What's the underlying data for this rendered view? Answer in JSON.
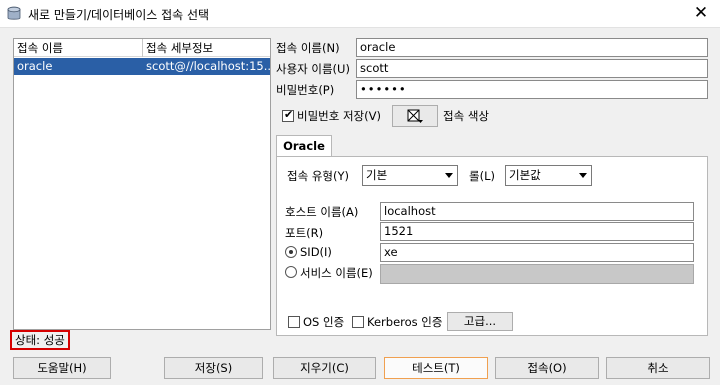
{
  "window": {
    "title": "새로 만들기/데이터베이스 접속 선택",
    "close_symbol": "✕"
  },
  "connection_list": {
    "columns": [
      "접속 이름",
      "접속 세부정보"
    ],
    "rows": [
      {
        "name": "oracle",
        "details": "scott@//localhost:15..."
      }
    ]
  },
  "form": {
    "connection_name": {
      "label": "접속 이름(N)",
      "value": "oracle"
    },
    "username": {
      "label": "사용자 이름(U)",
      "value": "scott"
    },
    "password": {
      "label": "비밀번호(P)",
      "value": "••••••"
    },
    "save_password": {
      "label": "비밀번호 저장(V)",
      "checked": true
    },
    "connection_color": {
      "label": "접속 색상"
    }
  },
  "tab": {
    "label": "Oracle"
  },
  "oracle": {
    "connection_type": {
      "label": "접속 유형(Y)",
      "value": "기본"
    },
    "role": {
      "label": "롤(L)",
      "value": "기본값"
    },
    "hostname": {
      "label": "호스트 이름(A)",
      "value": "localhost"
    },
    "port": {
      "label": "포트(R)",
      "value": "1521"
    },
    "sid": {
      "label": "SID(I)",
      "value": "xe",
      "selected": true
    },
    "service_name": {
      "label": "서비스 이름(E)",
      "value": "",
      "selected": false
    },
    "os_auth": {
      "label": "OS 인증",
      "checked": false
    },
    "kerberos_auth": {
      "label": "Kerberos 인증",
      "checked": false
    },
    "advanced_label": "고급..."
  },
  "status": {
    "text": "상태: 성공",
    "border_color": "#d60000"
  },
  "buttons": {
    "help": "도움말(H)",
    "save": "저장(S)",
    "clear": "지우기(C)",
    "test": "테스트(T)",
    "connect": "접속(O)",
    "cancel": "취소"
  },
  "colors": {
    "selection": "#2a5fa6",
    "accent": "#f0a050"
  }
}
